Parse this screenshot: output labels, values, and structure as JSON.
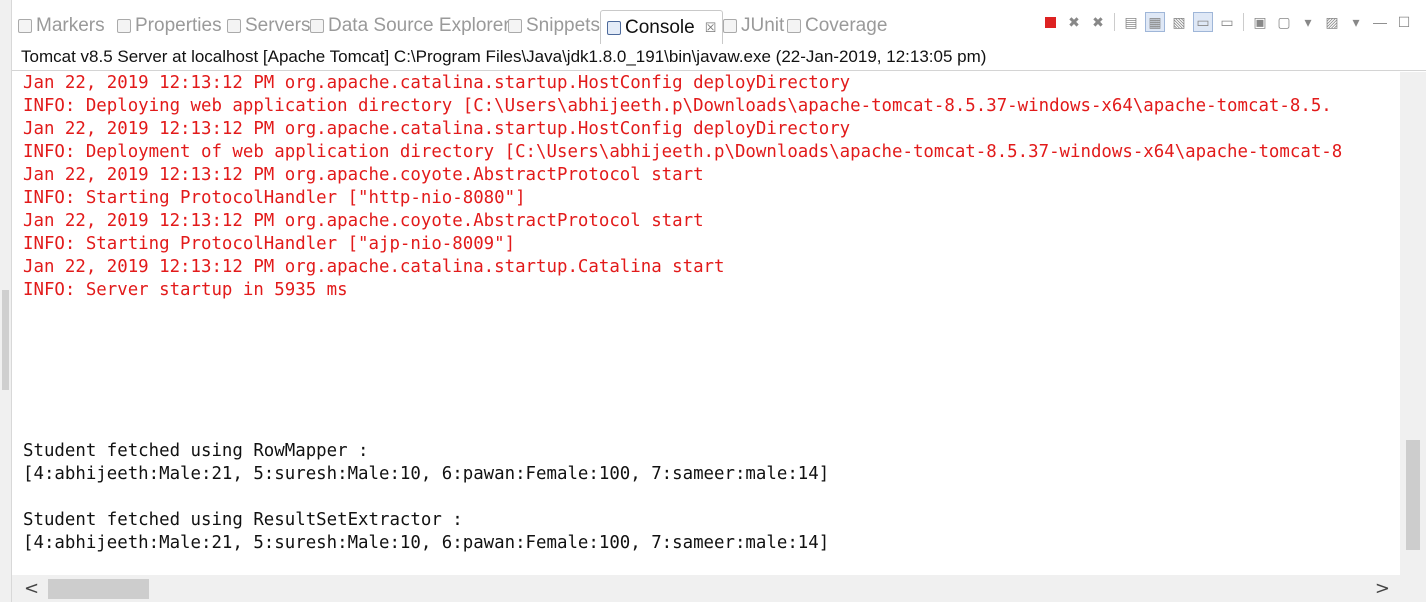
{
  "tabs": [
    {
      "label": "Markers"
    },
    {
      "label": "Properties"
    },
    {
      "label": "Servers"
    },
    {
      "label": "Data Source Explorer"
    },
    {
      "label": "Snippets"
    },
    {
      "label": "Console",
      "active": true,
      "close": "☒"
    },
    {
      "label": "JUnit"
    },
    {
      "label": "Coverage"
    }
  ],
  "console_header": "Tomcat v8.5 Server at localhost [Apache Tomcat] C:\\Program Files\\Java\\jdk1.8.0_191\\bin\\javaw.exe (22-Jan-2019, 12:13:05 pm)",
  "lines": [
    {
      "text": "Jan 22, 2019 12:13:12 PM org.apache.catalina.startup.HostConfig deployDirectory",
      "kind": "err"
    },
    {
      "text": "INFO: Deploying web application directory [C:\\Users\\abhijeeth.p\\Downloads\\apache-tomcat-8.5.37-windows-x64\\apache-tomcat-8.5.",
      "kind": "err"
    },
    {
      "text": "Jan 22, 2019 12:13:12 PM org.apache.catalina.startup.HostConfig deployDirectory",
      "kind": "err"
    },
    {
      "text": "INFO: Deployment of web application directory [C:\\Users\\abhijeeth.p\\Downloads\\apache-tomcat-8.5.37-windows-x64\\apache-tomcat-8",
      "kind": "err"
    },
    {
      "text": "Jan 22, 2019 12:13:12 PM org.apache.coyote.AbstractProtocol start",
      "kind": "err"
    },
    {
      "text": "INFO: Starting ProtocolHandler [\"http-nio-8080\"]",
      "kind": "err"
    },
    {
      "text": "Jan 22, 2019 12:13:12 PM org.apache.coyote.AbstractProtocol start",
      "kind": "err"
    },
    {
      "text": "INFO: Starting ProtocolHandler [\"ajp-nio-8009\"]",
      "kind": "err"
    },
    {
      "text": "Jan 22, 2019 12:13:12 PM org.apache.catalina.startup.Catalina start",
      "kind": "err"
    },
    {
      "text": "INFO: Server startup in 5935 ms",
      "kind": "err"
    },
    {
      "text": "",
      "kind": "out"
    },
    {
      "text": "",
      "kind": "out"
    },
    {
      "text": "",
      "kind": "out"
    },
    {
      "text": "",
      "kind": "out"
    },
    {
      "text": "",
      "kind": "out"
    },
    {
      "text": "",
      "kind": "out"
    },
    {
      "text": "Student fetched using RowMapper :",
      "kind": "out"
    },
    {
      "text": "[4:abhijeeth:Male:21, 5:suresh:Male:10, 6:pawan:Female:100, 7:sameer:male:14]",
      "kind": "out"
    },
    {
      "text": "",
      "kind": "out"
    },
    {
      "text": "Student fetched using ResultSetExtractor :",
      "kind": "out"
    },
    {
      "text": "[4:abhijeeth:Male:21, 5:suresh:Male:10, 6:pawan:Female:100, 7:sameer:male:14]",
      "kind": "out"
    }
  ],
  "toolbar": {
    "stop_icon": "stop-icon",
    "remove_icon": "remove-launch-icon",
    "remove_all_icon": "remove-all-icon",
    "minimize_glyph": "—",
    "maximize_glyph": "☐"
  },
  "scroll": {
    "left_arrow": "<",
    "right_arrow": ">"
  },
  "colors": {
    "stderr": "#e21a1a",
    "stdout": "#111111",
    "stop": "#dd2222"
  }
}
